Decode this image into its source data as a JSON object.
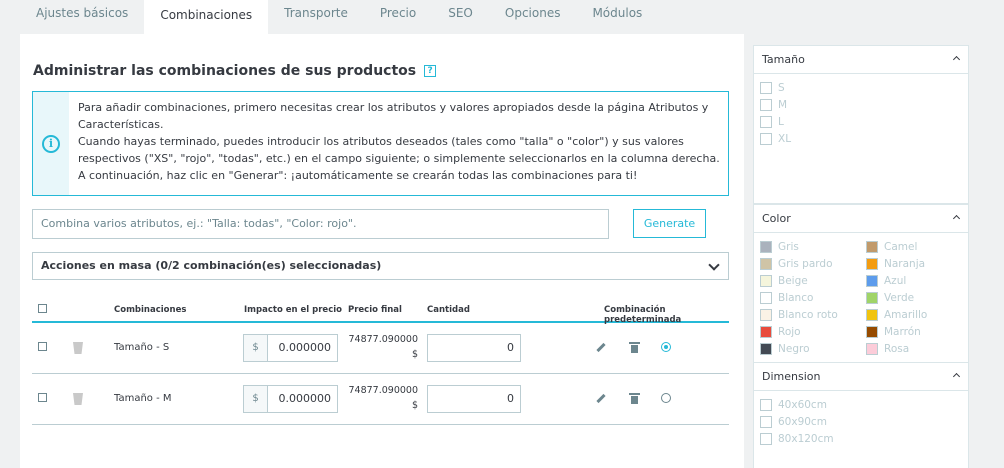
{
  "tabs": [
    "Ajustes básicos",
    "Combinaciones",
    "Transporte",
    "Precio",
    "SEO",
    "Opciones",
    "Módulos"
  ],
  "active_tab": "Combinaciones",
  "title": "Administrar las combinaciones de sus productos",
  "help_label": "?",
  "info_icon_label": "i",
  "info": {
    "p1": "Para añadir combinaciones, primero necesitas crear los atributos y valores apropiados desde la página Atributos y Características.",
    "p2": "Cuando hayas terminado, puedes introducir los atributos deseados (tales como \"talla\" o \"color\") y sus valores respectivos (\"XS\", \"rojo\", \"todas\", etc.) en el campo siguiente; o simplemente seleccionarlos en la columna derecha. A continuación, haz clic en \"Generar\": ¡automáticamente se crearán todas las combinaciones para ti!"
  },
  "generator": {
    "placeholder": "Combina varios atributos, ej.: \"Talla: todas\", \"Color: rojo\".",
    "button": "Generate"
  },
  "bulk_label": "Acciones en masa (0/2 combinación(es) seleccionadas)",
  "table": {
    "headers": {
      "combinations": "Combinaciones",
      "impact": "Impacto en el precio",
      "final": "Precio final",
      "quantity": "Cantidad",
      "default": "Combinación predeterminada"
    },
    "rows": [
      {
        "name": "Tamaño - S",
        "currency": "$",
        "impact": "0.000000",
        "final": "74877.090000",
        "final_currency": "$",
        "quantity": "0",
        "default": true
      },
      {
        "name": "Tamaño - M",
        "currency": "$",
        "impact": "0.000000",
        "final": "74877.090000",
        "final_currency": "$",
        "quantity": "0",
        "default": false
      }
    ]
  },
  "panels": {
    "size": {
      "title": "Tamaño",
      "options": [
        "S",
        "M",
        "L",
        "XL"
      ]
    },
    "color": {
      "title": "Color",
      "left": [
        {
          "label": "Gris",
          "color": "#aab2bd"
        },
        {
          "label": "Gris pardo",
          "color": "#cfc4a6"
        },
        {
          "label": "Beige",
          "color": "#f5f5dc"
        },
        {
          "label": "Blanco",
          "color": "#ffffff"
        },
        {
          "label": "Blanco roto",
          "color": "#faf2e6"
        },
        {
          "label": "Rojo",
          "color": "#e84c3d"
        },
        {
          "label": "Negro",
          "color": "#434a54"
        }
      ],
      "right": [
        {
          "label": "Camel",
          "color": "#c19a6b"
        },
        {
          "label": "Naranja",
          "color": "#f39c11"
        },
        {
          "label": "Azul",
          "color": "#5d9cec"
        },
        {
          "label": "Verde",
          "color": "#a0d468"
        },
        {
          "label": "Amarillo",
          "color": "#f1c40f"
        },
        {
          "label": "Marrón",
          "color": "#964b00"
        },
        {
          "label": "Rosa",
          "color": "#fcccd9"
        }
      ]
    },
    "dimension": {
      "title": "Dimension",
      "options": [
        "40x60cm",
        "60x90cm",
        "80x120cm"
      ]
    }
  }
}
